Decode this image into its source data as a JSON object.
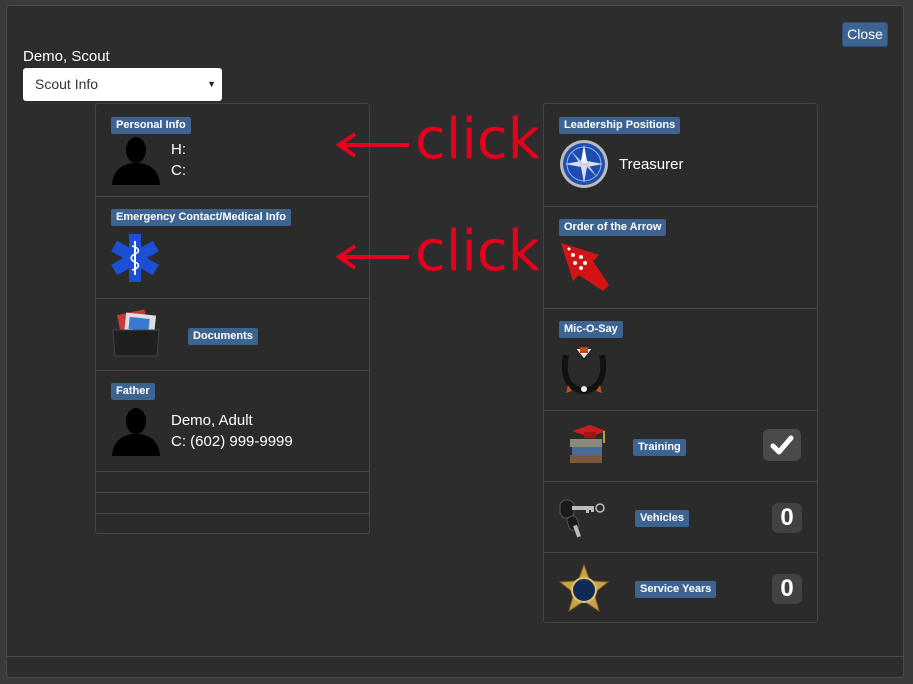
{
  "header": {
    "scout_name": "Demo, Scout",
    "close_label": "Close",
    "select_value": "Scout Info"
  },
  "left": {
    "personal": {
      "label": "Personal Info",
      "home": "H:",
      "cell": "C:"
    },
    "emergency": {
      "label": "Emergency Contact/Medical Info"
    },
    "documents": {
      "label": "Documents"
    },
    "father": {
      "label": "Father",
      "name": "Demo, Adult",
      "phone": "C: (602) 999-9999"
    }
  },
  "right": {
    "leadership": {
      "label": "Leadership Positions",
      "position": "Treasurer"
    },
    "oa": {
      "label": "Order of the Arrow"
    },
    "mic": {
      "label": "Mic-O-Say"
    },
    "training": {
      "label": "Training"
    },
    "vehicles": {
      "label": "Vehicles",
      "count": "0"
    },
    "service": {
      "label": "Service Years",
      "count": "0"
    }
  },
  "annotations": {
    "click1": "click",
    "click2": "click"
  },
  "colors": {
    "accent": "#3d6490",
    "annotation": "#e5001c",
    "background": "#2d2d2d"
  }
}
